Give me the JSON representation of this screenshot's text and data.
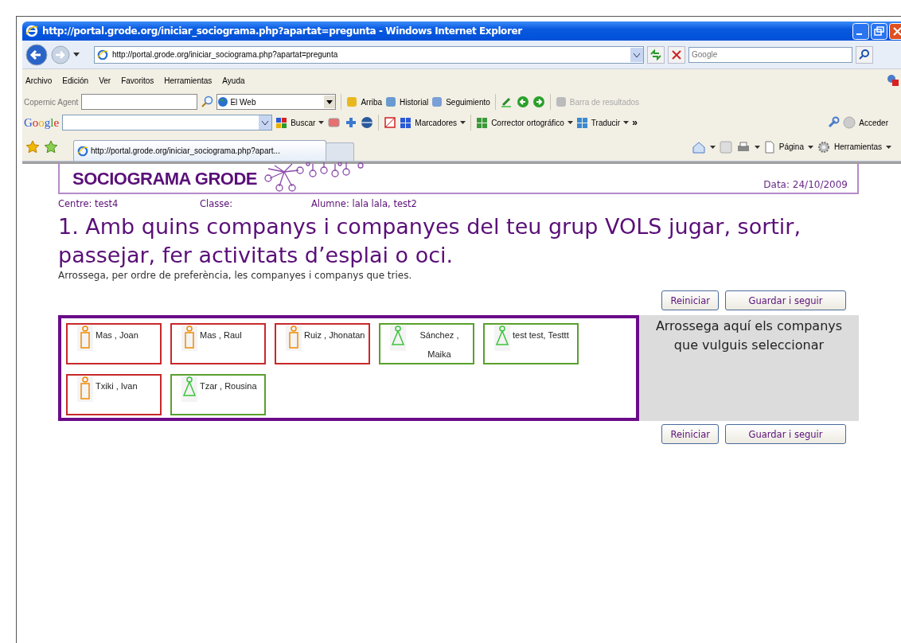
{
  "window": {
    "title": "http://portal.grode.org/iniciar_sociograma.php?apartat=pregunta - Windows Internet Explorer"
  },
  "address_bar": {
    "url": "http://portal.grode.org/iniciar_sociograma.php?apartat=pregunta",
    "search_placeholder": "Google"
  },
  "menu": [
    "Archivo",
    "Edición",
    "Ver",
    "Favoritos",
    "Herramientas",
    "Ayuda"
  ],
  "copernic_toolbar": {
    "label": "Copernic Agent",
    "scope": "El Web",
    "buttons": [
      {
        "label": "Arriba",
        "disabled": false
      },
      {
        "label": "Historial",
        "disabled": false
      },
      {
        "label": "Seguimiento",
        "disabled": false
      },
      {
        "label": "Barra de resultados",
        "disabled": true
      }
    ]
  },
  "google_toolbar": {
    "logo": "Google",
    "buttons": [
      "Buscar",
      "Marcadores",
      "Corrector ortográfico",
      "Traducir"
    ],
    "more": "»",
    "sign_in": "Acceder"
  },
  "tabs": [
    {
      "title": "http://portal.grode.org/iniciar_sociograma.php?apart...",
      "selected": true
    }
  ],
  "command_bar": [
    "Página",
    "Herramientas"
  ],
  "page": {
    "brand": "SOCIOGRAMA GRODE",
    "date": "Data: 24/10/2009",
    "info": [
      "Centre: test4",
      "Classe:",
      "Alumne: lala lala, test2"
    ],
    "question": "1. Amb quins companys i companyes del teu grup VOLS jugar, sortir, passejar, fer activitats d’esplai o oci.",
    "instruction": "Arrossega, per ordre de preferència, les companyes i companys que tries.",
    "buttons_top": [
      "Reiniciar",
      "Guardar i seguir"
    ],
    "students": [
      {
        "name": "Mas , Joan",
        "kind": "boy"
      },
      {
        "name": "Mas , Raul",
        "kind": "boy"
      },
      {
        "name": "Ruiz , Jhonatan",
        "kind": "boy"
      },
      {
        "name": "Sánchez , Maika",
        "kind": "girl"
      },
      {
        "name": "test test, Testtt",
        "kind": "girl"
      },
      {
        "name": "Txiki , Ivan",
        "kind": "boy"
      },
      {
        "name": "Tzar , Rousina",
        "kind": "girl"
      }
    ],
    "drop_hint": "Arrossega aquí els companys que vulguis seleccionar",
    "buttons_bottom": [
      "Reiniciar",
      "Guardar i seguir"
    ]
  }
}
